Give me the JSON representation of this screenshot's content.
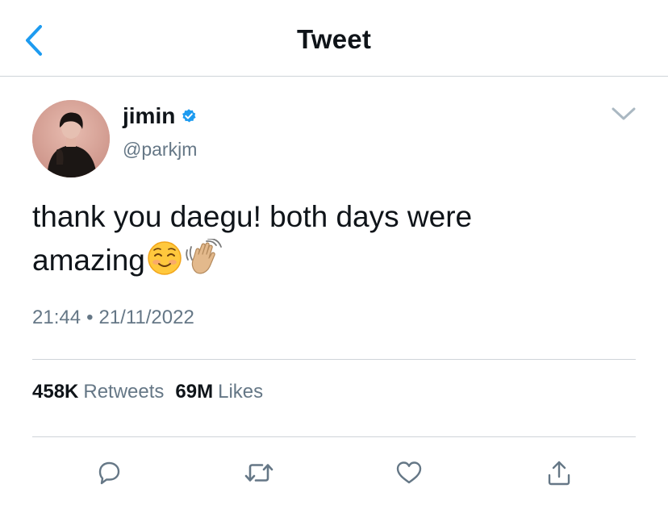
{
  "header": {
    "title": "Tweet",
    "back_icon": "chevron-left-icon"
  },
  "tweet": {
    "author": {
      "display_name": "jimin",
      "handle": "@parkjm",
      "verified": true,
      "verified_icon": "verified-badge-icon"
    },
    "text_line1": "thank you daegu! both days were",
    "text_line2": "amazing",
    "emojis": [
      "smiling-face-emoji",
      "waving-hand-emoji"
    ],
    "time": "21:44",
    "separator": "•",
    "date": "21/11/2022"
  },
  "stats": {
    "retweets_count": "458K",
    "retweets_label": "Retweets",
    "likes_count": "69M",
    "likes_label": "Likes"
  },
  "actions": {
    "reply_icon": "reply-icon",
    "retweet_icon": "retweet-icon",
    "like_icon": "heart-icon",
    "share_icon": "share-icon"
  },
  "colors": {
    "accent": "#1d9bf0",
    "text_primary": "#0f1419",
    "text_secondary": "#657786",
    "divider": "#cfd4d9"
  }
}
